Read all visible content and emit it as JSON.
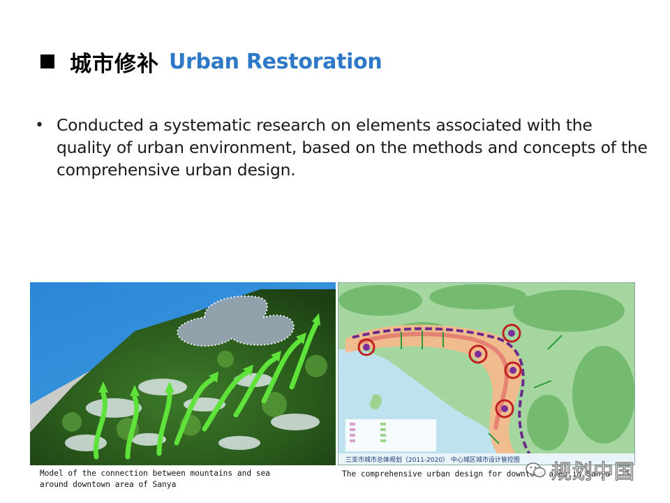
{
  "slide": {
    "title_cn": "城市修补",
    "title_en": "Urban Restoration",
    "title_en_color": "#2e78c8",
    "bullet": "Conducted a systematic research on elements associated with the quality of urban environment, based on the methods and concepts of the comprehensive urban design."
  },
  "images": {
    "left": {
      "caption": "Model of the connection between mountains and sea\naround downtown area of Sanya"
    },
    "right": {
      "map_title": "三亚市城市总体规划（2011-2020）  中心城区城市设计管控图",
      "caption": "The comprehensive urban design for downtown area in Sanya"
    }
  },
  "watermark": {
    "icon": "chat-bubble-icon",
    "text": "规划中国"
  }
}
